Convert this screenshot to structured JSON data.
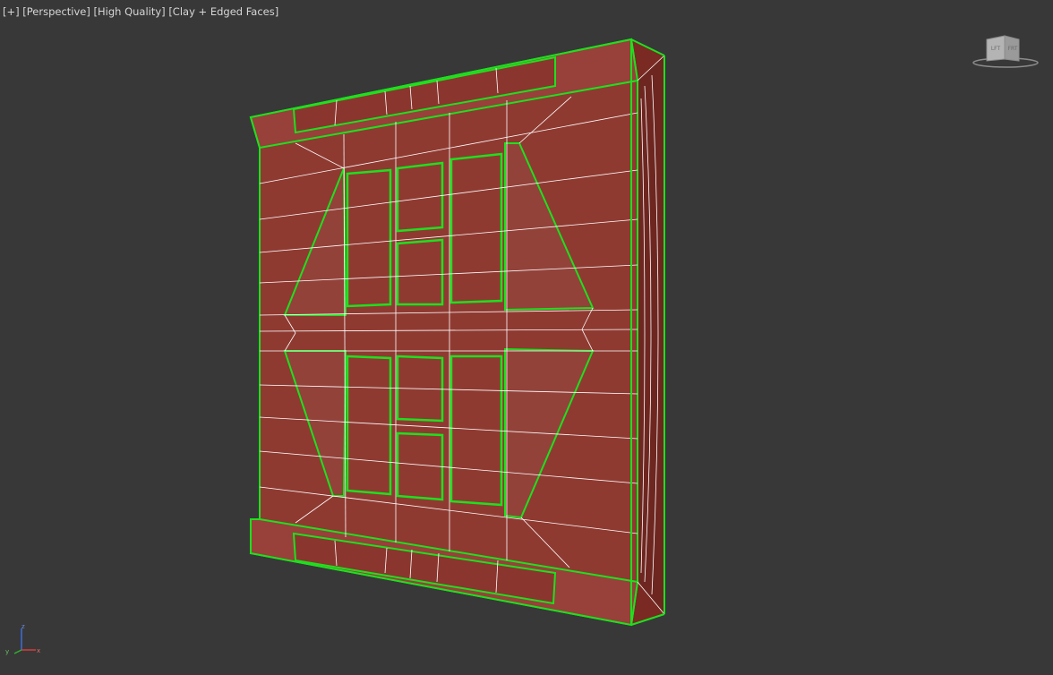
{
  "viewport": {
    "menu_plus": "[+]",
    "view_mode": "[Perspective]",
    "quality": "[High Quality]",
    "shading": "[Clay + Edged Faces]"
  },
  "viewcube": {
    "left_face": "LFT",
    "right_face": "FRT"
  },
  "axis": {
    "x": "x",
    "y": "y",
    "z": "z"
  },
  "colors": {
    "background": "#383838",
    "clay": "#8f3a31",
    "edge_selected": "#1ee01e",
    "wire": "#ffffff"
  }
}
